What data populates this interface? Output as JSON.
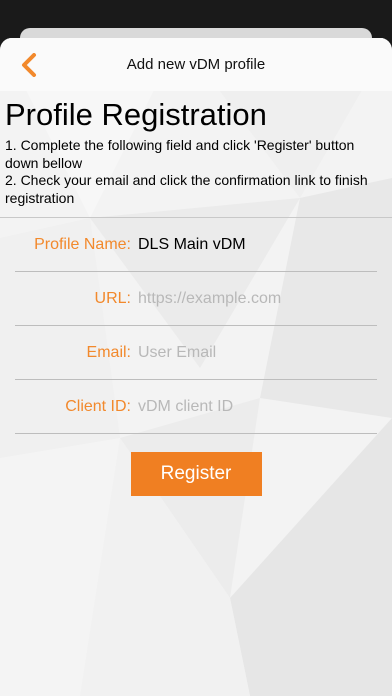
{
  "navbar": {
    "title": "Add new vDM profile",
    "back_icon": "chevron-left-icon",
    "accent_color": "#f2892c"
  },
  "page": {
    "heading": "Profile Registration",
    "instruction_1": "1. Complete the following field and click 'Register' button down bellow",
    "instruction_2": "2. Check your email and click the confirmation link to finish registration"
  },
  "form": {
    "profile_name": {
      "label": "Profile Name:",
      "value": "DLS Main vDM",
      "placeholder": ""
    },
    "url": {
      "label": "URL:",
      "value": "",
      "placeholder": "https://example.com"
    },
    "email": {
      "label": "Email:",
      "value": "",
      "placeholder": "User Email"
    },
    "client_id": {
      "label": "Client ID:",
      "value": "",
      "placeholder": "vDM client ID"
    }
  },
  "actions": {
    "register_label": "Register",
    "register_color": "#f07f22"
  }
}
